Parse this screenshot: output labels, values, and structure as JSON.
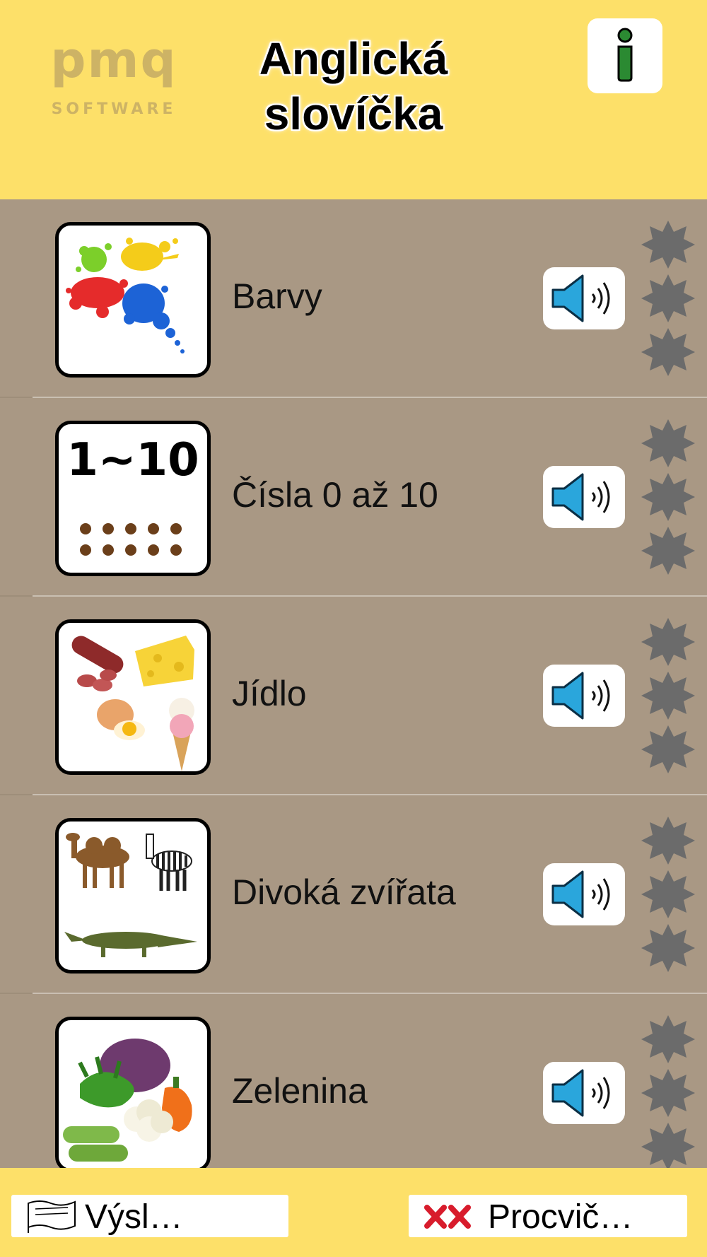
{
  "header": {
    "logo_main": "pmq",
    "logo_sub": "SOFTWARE",
    "title_line1": "Anglická",
    "title_line2": "slovíčka",
    "info_icon": "info-icon"
  },
  "colors": {
    "header_bg": "#fde069",
    "list_bg": "#a99884",
    "star_gray": "#6b6b6b",
    "speaker_blue": "#2aa6dc"
  },
  "categories": [
    {
      "label": "Barvy",
      "image": "paint-splash-image",
      "stars": 0
    },
    {
      "label": "Čísla 0 až 10",
      "image": "numbers-image",
      "thumb_text": "1~10",
      "stars": 0
    },
    {
      "label": "Jídlo",
      "image": "food-image",
      "stars": 0
    },
    {
      "label": "Divoká zvířata",
      "image": "wild-animals-image",
      "stars": 0
    },
    {
      "label": "Zelenina",
      "image": "vegetables-image",
      "stars": 0
    }
  ],
  "footer": {
    "results_label": "Výsl…",
    "practice_label": "Procvič…"
  }
}
